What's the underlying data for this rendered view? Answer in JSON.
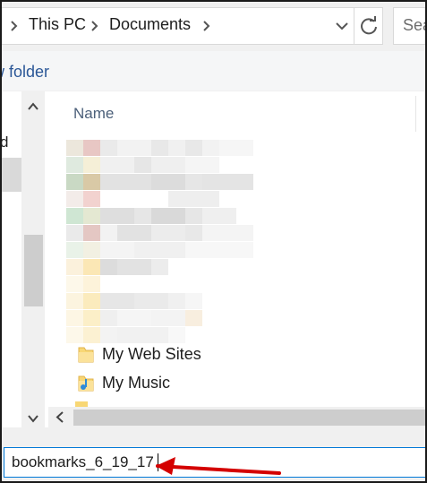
{
  "breadcrumb": {
    "items": [
      "This PC",
      "Documents"
    ]
  },
  "search": {
    "placeholder": "Sea"
  },
  "toolbar": {
    "new_folder_label": "w folder"
  },
  "nav_pane": {
    "partial_label": "d"
  },
  "file_list": {
    "column_name": "Name",
    "folders": [
      {
        "label": "My Web Sites",
        "icon": "folder-icon"
      },
      {
        "label": "My Music",
        "icon": "music-folder-icon"
      }
    ]
  },
  "filename": {
    "value": "bookmarks_6_19_17"
  },
  "colors": {
    "accent": "#0078d7",
    "annotation_arrow": "#d40000",
    "folder_yellow": "#f8d775",
    "link_blue": "#2b5797"
  }
}
